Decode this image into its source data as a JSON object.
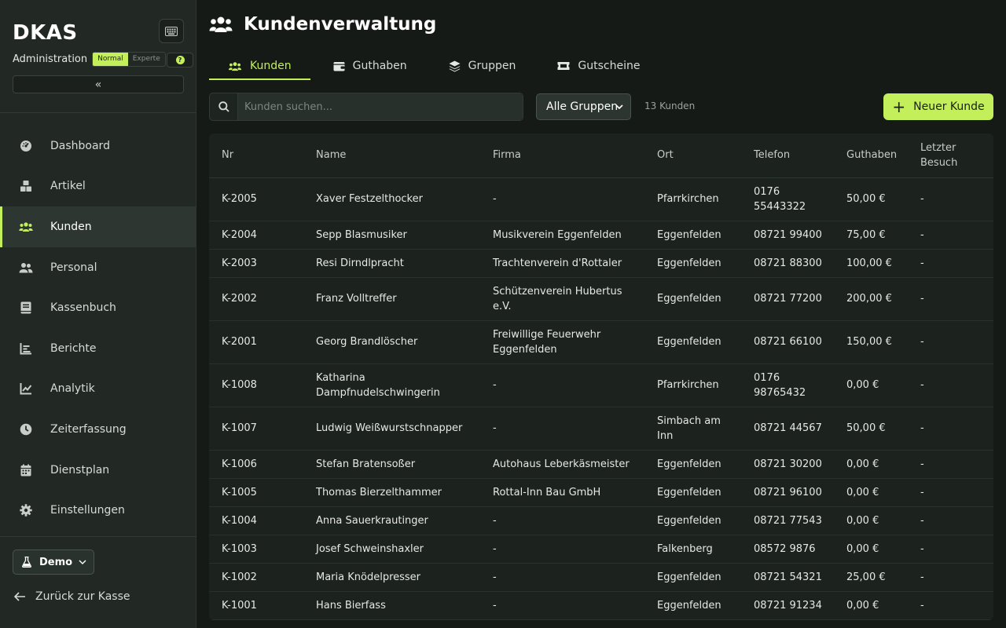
{
  "sidebar": {
    "logo": "DKAS",
    "admin_label": "Administration",
    "mode_normal": "Normal",
    "mode_expert": "Experte",
    "help_label": "?",
    "collapse_label": "«",
    "nav": [
      {
        "label": "Dashboard",
        "icon": "dashboard-icon"
      },
      {
        "label": "Artikel",
        "icon": "boxes-icon"
      },
      {
        "label": "Kunden",
        "icon": "users-icon",
        "active": true
      },
      {
        "label": "Personal",
        "icon": "user-group-icon"
      },
      {
        "label": "Kassenbuch",
        "icon": "book-icon"
      },
      {
        "label": "Berichte",
        "icon": "bar-chart-icon"
      },
      {
        "label": "Analytik",
        "icon": "line-chart-icon"
      },
      {
        "label": "Zeiterfassung",
        "icon": "clock-icon"
      },
      {
        "label": "Dienstplan",
        "icon": "calendar-icon"
      },
      {
        "label": "Einstellungen",
        "icon": "gear-icon"
      }
    ],
    "demo_label": "Demo",
    "back_label": "Zurück zur Kasse"
  },
  "header": {
    "title": "Kundenverwaltung"
  },
  "tabs": [
    {
      "label": "Kunden",
      "active": true
    },
    {
      "label": "Guthaben"
    },
    {
      "label": "Gruppen"
    },
    {
      "label": "Gutscheine"
    }
  ],
  "toolbar": {
    "search_placeholder": "Kunden suchen...",
    "group_select": "Alle Gruppen",
    "count": "13 Kunden",
    "new_button": "Neuer Kunde"
  },
  "table": {
    "columns": [
      "Nr",
      "Name",
      "Firma",
      "Ort",
      "Telefon",
      "Guthaben",
      "Letzter Besuch"
    ],
    "rows": [
      [
        "K-2005",
        "Xaver Festzelthocker",
        "-",
        "Pfarrkirchen",
        "0176 55443322",
        "50,00 €",
        "-"
      ],
      [
        "K-2004",
        "Sepp Blasmusiker",
        "Musikverein Eggenfelden",
        "Eggenfelden",
        "08721 99400",
        "75,00 €",
        "-"
      ],
      [
        "K-2003",
        "Resi Dirndlpracht",
        "Trachtenverein d'Rottaler",
        "Eggenfelden",
        "08721 88300",
        "100,00 €",
        "-"
      ],
      [
        "K-2002",
        "Franz Volltreffer",
        "Schützenverein Hubertus e.V.",
        "Eggenfelden",
        "08721 77200",
        "200,00 €",
        "-"
      ],
      [
        "K-2001",
        "Georg Brandlöscher",
        "Freiwillige Feuerwehr Eggenfelden",
        "Eggenfelden",
        "08721 66100",
        "150,00 €",
        "-"
      ],
      [
        "K-1008",
        "Katharina Dampfnudelschwingerin",
        "-",
        "Pfarrkirchen",
        "0176 98765432",
        "0,00 €",
        "-"
      ],
      [
        "K-1007",
        "Ludwig Weißwurstschnapper",
        "-",
        "Simbach am Inn",
        "08721 44567",
        "50,00 €",
        "-"
      ],
      [
        "K-1006",
        "Stefan Bratensoßer",
        "Autohaus Leberkäsmeister",
        "Eggenfelden",
        "08721 30200",
        "0,00 €",
        "-"
      ],
      [
        "K-1005",
        "Thomas Bierzelthammer",
        "Rottal-Inn Bau GmbH",
        "Eggenfelden",
        "08721 96100",
        "0,00 €",
        "-"
      ],
      [
        "K-1004",
        "Anna Sauerkrautinger",
        "-",
        "Eggenfelden",
        "08721 77543",
        "0,00 €",
        "-"
      ],
      [
        "K-1003",
        "Josef Schweinshaxler",
        "-",
        "Falkenberg",
        "08572 9876",
        "0,00 €",
        "-"
      ],
      [
        "K-1002",
        "Maria Knödelpresser",
        "-",
        "Eggenfelden",
        "08721 54321",
        "25,00 €",
        "-"
      ],
      [
        "K-1001",
        "Hans Bierfass",
        "-",
        "Eggenfelden",
        "08721 91234",
        "0,00 €",
        "-"
      ]
    ]
  },
  "colors": {
    "accent": "#c3ef5b",
    "sidebar_bg": "#222925",
    "main_bg": "#161a17"
  }
}
